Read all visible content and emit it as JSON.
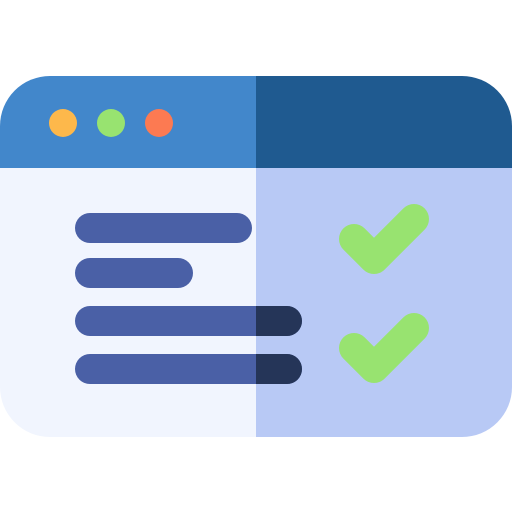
{
  "illustration": {
    "window_bar_left_color": "#4287CB",
    "window_bar_right_color": "#1F5A90",
    "content_left_color": "#F1F5FE",
    "content_right_color": "#B8C9F5",
    "traffic_lights": [
      {
        "name": "yellow",
        "color": "#FDB84B"
      },
      {
        "name": "green",
        "color": "#98E370"
      },
      {
        "name": "orange",
        "color": "#FC7A52"
      }
    ],
    "text_lines": [
      {
        "length_fraction": 0.78,
        "color": "#4A60A6",
        "shade_color": "#253558"
      },
      {
        "length_fraction": 0.52,
        "color": "#4A60A6",
        "shade_color": "#253558"
      },
      {
        "length_fraction": 1.0,
        "color": "#4A60A6",
        "shade_color": "#253558"
      },
      {
        "length_fraction": 1.0,
        "color": "#4A60A6",
        "shade_color": "#253558"
      }
    ],
    "checkmarks": [
      {
        "icon": "check-icon",
        "color": "#98E370"
      },
      {
        "icon": "check-icon",
        "color": "#98E370"
      }
    ]
  }
}
